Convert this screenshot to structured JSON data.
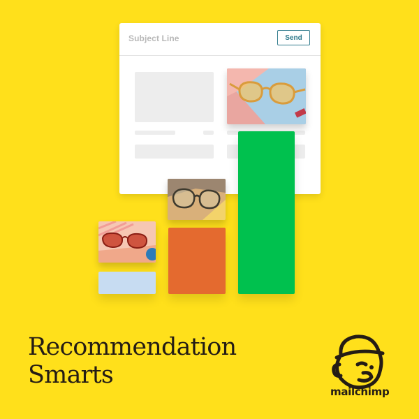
{
  "email": {
    "subject_placeholder": "Subject Line",
    "send_label": "Send"
  },
  "bars": {
    "colors": {
      "light_blue": "#C7DCF2",
      "orange": "#E46A2F",
      "green": "#00C14E"
    }
  },
  "headline": {
    "line1": "Recommendation",
    "line2": "Smarts"
  },
  "brand": {
    "name": "mailchimp",
    "background": "#FFE01B",
    "ink": "#241C15"
  },
  "icons": {
    "logo": "mailchimp-freddie-logo-icon"
  }
}
